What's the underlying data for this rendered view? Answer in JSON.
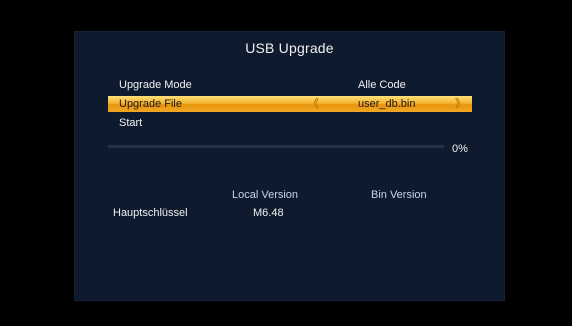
{
  "dialog": {
    "title": "USB Upgrade"
  },
  "menu": {
    "upgrade_mode": {
      "label": "Upgrade Mode",
      "value": "Alle Code"
    },
    "upgrade_file": {
      "label": "Upgrade File",
      "value": "user_db.bin",
      "arrow_left": "《",
      "arrow_right": "》"
    },
    "start": {
      "label": "Start"
    }
  },
  "progress": {
    "percent": 0,
    "text": "0%"
  },
  "versions": {
    "header_local": "Local Version",
    "header_bin": "Bin Version",
    "rows": [
      {
        "name": "Hauptschlüssel",
        "local": "M6.48",
        "bin": ""
      }
    ]
  },
  "colors": {
    "highlight": "#f0a826",
    "panel_bg": "#0e1a2e",
    "screen_bg": "#000000"
  }
}
